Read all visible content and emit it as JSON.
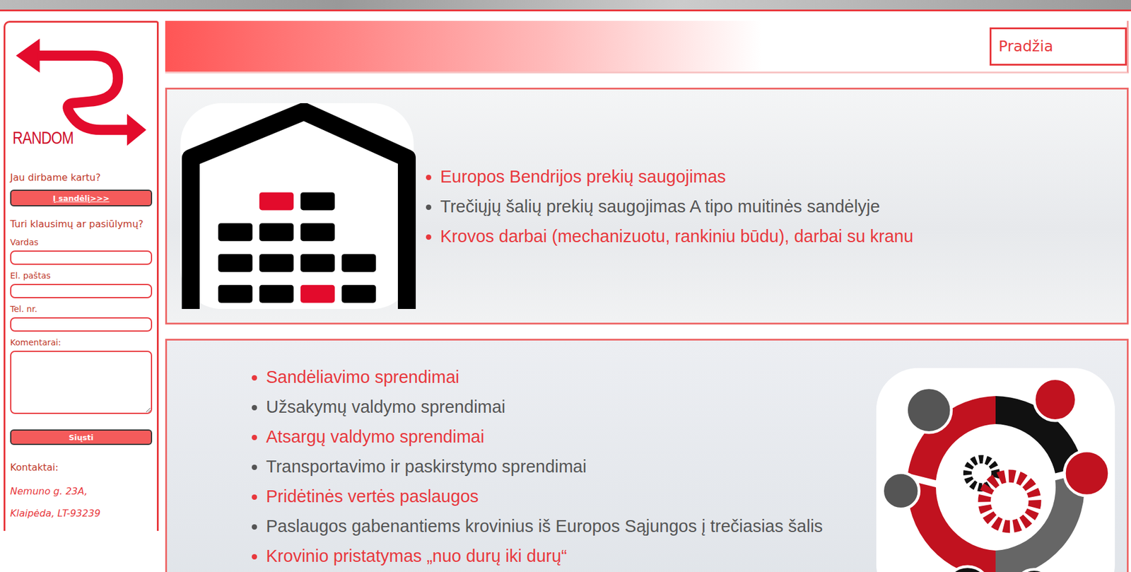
{
  "sidebar": {
    "logo": {
      "text": "RANDOM"
    },
    "question": "Jau dirbame kartu?",
    "warehouse_button": "Į sandėlį>>>",
    "form": {
      "title": "Turi klausimų ar pasiūlymų?",
      "fields": [
        {
          "label": "Vardas",
          "kind": "input"
        },
        {
          "label": "El. paštas",
          "kind": "input"
        },
        {
          "label": "Tel. nr.",
          "kind": "input"
        },
        {
          "label": "Komentarai:",
          "kind": "textarea"
        }
      ],
      "submit": "Siųsti"
    },
    "contacts": {
      "title": "Kontaktai:",
      "lines": [
        "Nemuno g. 23A,",
        "Klaipėda, LT-93239"
      ]
    }
  },
  "header": {
    "nav_button": "Pradžia"
  },
  "warehouse_services": [
    {
      "text": "Europos Bendrijos prekių saugojimas",
      "color": "#e8383d"
    },
    {
      "text": "Trečiųjų šalių prekių saugojimas A tipo muitinės sandėlyje",
      "color": "#555555"
    },
    {
      "text": "Krovos darbai (mechanizuotu, rankiniu būdu), darbai su kranu",
      "color": "#e8383d"
    }
  ],
  "logistics_solutions": [
    {
      "text": "Sandėliavimo sprendimai",
      "color": "#e8383d"
    },
    {
      "text": "Užsakymų valdymo sprendimai",
      "color": "#555555"
    },
    {
      "text": "Atsargų valdymo sprendimai",
      "color": "#e8383d"
    },
    {
      "text": "Transportavimo ir paskirstymo sprendimai",
      "color": "#555555"
    },
    {
      "text": "Pridėtinės vertės paslaugos",
      "color": "#e8383d"
    },
    {
      "text": "Paslaugos gabenantiems krovinius iš Europos Sąjungos į trečiasias šalis",
      "color": "#555555"
    },
    {
      "text": "Krovinio pristatymas „nuo durų iki durų“",
      "color": "#e8383d"
    }
  ]
}
